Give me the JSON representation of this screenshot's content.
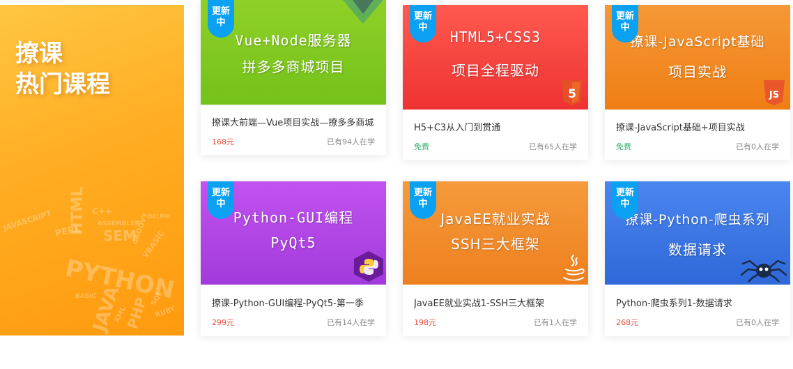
{
  "promo": {
    "title_line1": "撩课",
    "title_line2": "热门课程",
    "cloud_words": [
      "JAVASCRIPT",
      "HTML",
      "C++",
      "PERL",
      "SEM",
      "PYTHON",
      "ASSEMBLER",
      "GROOVY",
      "DELPHI",
      "VBASIC",
      "JAVA",
      "XML",
      "PHP",
      "RUBY",
      "BASIC",
      "SQL"
    ]
  },
  "badge_text": [
    "更新",
    "中"
  ],
  "courses": [
    {
      "thumb_lines": [
        "Vue+Node服务器",
        "拼多多商城项目"
      ],
      "title": "撩课大前端—Vue项目实战—撩多多商城",
      "price": "168元",
      "learners": "已有94人在学",
      "price_kind": "paid",
      "logo_icon": "vue-logo-icon"
    },
    {
      "thumb_lines": [
        "HTML5+CSS3",
        "项目全程驱动"
      ],
      "title": "H5+C3从入门到贯通",
      "price": "免费",
      "learners": "已有65人在学",
      "price_kind": "free",
      "logo_icon": "html5-logo-icon"
    },
    {
      "thumb_lines": [
        "撩课-JavaScript基础",
        "项目实战"
      ],
      "title": "撩课-JavaScript基础+项目实战",
      "price": "免费",
      "learners": "已有0人在学",
      "price_kind": "free",
      "logo_icon": "js-logo-icon"
    },
    {
      "thumb_lines": [
        "Python-GUI编程",
        "PyQt5"
      ],
      "title": "撩课-Python-GUI编程-PyQt5-第一季",
      "price": "299元",
      "learners": "已有14人在学",
      "price_kind": "paid",
      "logo_icon": "python-logo-icon"
    },
    {
      "thumb_lines": [
        "JavaEE就业实战",
        "SSH三大框架"
      ],
      "title": "JavaEE就业实战1-SSH三大框架",
      "price": "198元",
      "learners": "已有1人在学",
      "price_kind": "paid",
      "logo_icon": "java-logo-icon"
    },
    {
      "thumb_lines": [
        "撩课-Python-爬虫系列",
        "数据请求"
      ],
      "title": "Python-爬虫系列1-数据请求",
      "price": "268元",
      "learners": "已有0人在学",
      "price_kind": "paid",
      "logo_icon": "spider-logo-icon"
    }
  ],
  "colors": {
    "badge": "#0aa1f2",
    "paid_price": "#e74c3c",
    "free_price": "#3cb371",
    "vue_thumb": "#7cc820",
    "html_thumb": "#f03c3c",
    "js_thumb": "#f08a22",
    "pyqt_thumb": "#a63fe0",
    "java_thumb": "#f2852a",
    "spider_thumb": "#3a7be8"
  }
}
